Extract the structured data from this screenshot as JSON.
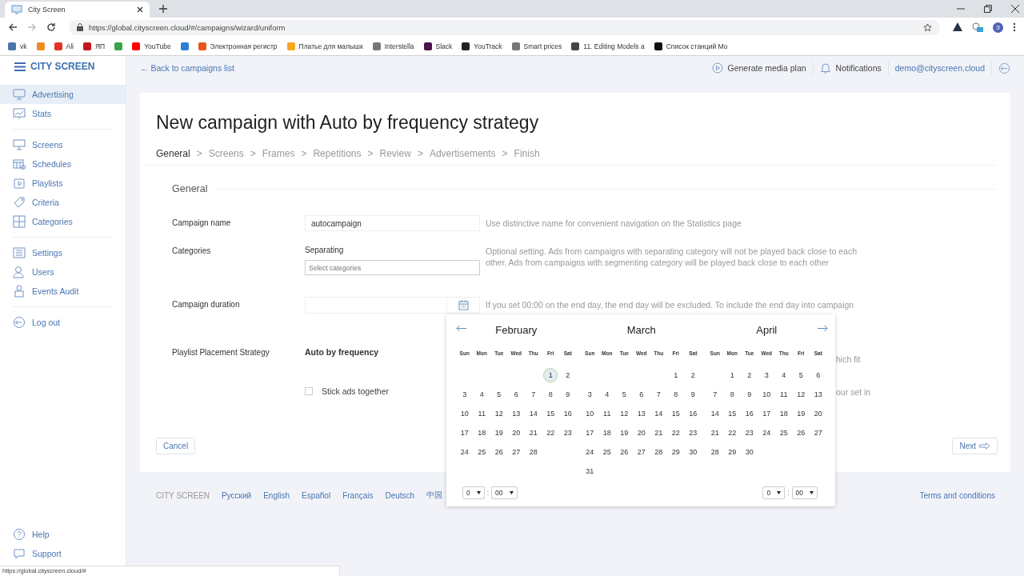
{
  "browser": {
    "tab_title": "City Screen",
    "url": "https://global.cityscreen.cloud/#/campaigns/wizard/uniform",
    "profile_initial": "З",
    "bookmarks": [
      {
        "label": "vk",
        "color": "#4a76a8"
      },
      {
        "color": "#f08a24"
      },
      {
        "label": "Ali",
        "color": "#e43225"
      },
      {
        "label": "ЯП",
        "color": "#c4161c"
      },
      {
        "color": "#3aa34a"
      },
      {
        "label": "YouTube",
        "color": "#ff0000"
      },
      {
        "color": "#2a7fd4"
      },
      {
        "label": "Электронная регистр",
        "color": "#e8541c"
      },
      {
        "label": "Платье для малышк",
        "color": "#f5a623"
      },
      {
        "label": "Interstella",
        "color": "#777777"
      },
      {
        "label": "Slack",
        "color": "#4a154b"
      },
      {
        "label": "YouTrack",
        "color": "#222222"
      },
      {
        "label": "Smart prices",
        "color": "#777777"
      },
      {
        "label": "11. Editing Models a",
        "color": "#444444"
      },
      {
        "label": "Список станций Mo",
        "color": "#111111"
      }
    ]
  },
  "sidebar": {
    "brand": "CITY SCREEN",
    "groups": [
      {
        "items": [
          {
            "label": "Advertising",
            "selected": true
          },
          {
            "label": "Stats",
            "selected": false
          }
        ]
      },
      {
        "items": [
          {
            "label": "Screens",
            "selected": false
          },
          {
            "label": "Schedules",
            "selected": false
          },
          {
            "label": "Playlists",
            "selected": false
          },
          {
            "label": "Criteria",
            "selected": false
          },
          {
            "label": "Categories",
            "selected": false
          }
        ]
      },
      {
        "items": [
          {
            "label": "Settings",
            "selected": false
          },
          {
            "label": "Users",
            "selected": false
          },
          {
            "label": "Events Audit",
            "selected": false
          }
        ]
      },
      {
        "items": [
          {
            "label": "Log out",
            "selected": false
          }
        ]
      }
    ],
    "bottom_items": [
      {
        "label": "Help",
        "selected": false
      },
      {
        "label": "Support",
        "selected": false
      }
    ]
  },
  "header": {
    "back_link": "← Back to campaigns list",
    "media_plan": "Generate media plan",
    "notifications": "Notifications",
    "user": "demo@cityscreen.cloud"
  },
  "page": {
    "title": "New campaign with Auto by frequency strategy",
    "separator": ">",
    "steps": [
      {
        "label": "General",
        "selected": true
      },
      {
        "label": "Screens",
        "selected": false
      },
      {
        "label": "Frames",
        "selected": false
      },
      {
        "label": "Repetitions",
        "selected": false
      },
      {
        "label": "Review",
        "selected": false
      },
      {
        "label": "Advertisements",
        "selected": false
      },
      {
        "label": "Finish",
        "selected": false
      }
    ],
    "section": "General",
    "campaign_name": {
      "label": "Campaign name",
      "value": "autocampaign",
      "hint": "Use distinctive name for convenient navigation on the Statistics page"
    },
    "categories": {
      "label": "Categories",
      "sublabel": "Separating",
      "placeholder": "Select categories",
      "hint": "Optional setting. Ads from campaigns with separating category will not be played back close to each other. Ads from campaigns with segmenting category will be played back close to each other"
    },
    "duration": {
      "label": "Campaign duration",
      "hint": "If you set 00:00 on the end day, the end day will be excluded. To include the end day into campaign"
    },
    "strategy": {
      "label": "Playlist Placement Strategy",
      "value": "Auto by frequency",
      "hint_fragment": "hich fit"
    },
    "stick_ads": {
      "label": "Stick ads together",
      "checked": false,
      "hint_fragment": "our set in"
    },
    "cancel": "Cancel",
    "next": "Next"
  },
  "calendar": {
    "months": [
      {
        "name": "February",
        "weekdays": [
          "Sun",
          "Mon",
          "Tue",
          "Wed",
          "Thu",
          "Fri",
          "Sat"
        ],
        "weeks": [
          [
            {
              "d": "1",
              "selected": true
            },
            {
              "d": "2",
              "selected": false
            }
          ],
          [
            {
              "d": "3",
              "selected": false
            },
            {
              "d": "4",
              "selected": false
            },
            {
              "d": "5",
              "selected": false
            },
            {
              "d": "6",
              "selected": false
            },
            {
              "d": "7",
              "selected": false
            },
            {
              "d": "8",
              "selected": false
            },
            {
              "d": "9",
              "selected": false
            }
          ],
          [
            {
              "d": "10",
              "selected": false
            },
            {
              "d": "11",
              "selected": false
            },
            {
              "d": "12",
              "selected": false
            },
            {
              "d": "13",
              "selected": false
            },
            {
              "d": "14",
              "selected": false
            },
            {
              "d": "15",
              "selected": false
            },
            {
              "d": "16",
              "selected": false
            }
          ],
          [
            {
              "d": "17",
              "selected": false
            },
            {
              "d": "18",
              "selected": false
            },
            {
              "d": "19",
              "selected": false
            },
            {
              "d": "20",
              "selected": false
            },
            {
              "d": "21",
              "selected": false
            },
            {
              "d": "22",
              "selected": false
            },
            {
              "d": "23",
              "selected": false
            }
          ],
          [
            {
              "d": "24",
              "selected": false
            },
            {
              "d": "25",
              "selected": false
            },
            {
              "d": "26",
              "selected": false
            },
            {
              "d": "27",
              "selected": false
            },
            {
              "d": "28",
              "selected": false
            }
          ]
        ]
      },
      {
        "name": "March",
        "weekdays": [
          "Sun",
          "Mon",
          "Tue",
          "Wed",
          "Thu",
          "Fri",
          "Sat"
        ],
        "weeks": [
          [
            {
              "d": "1",
              "selected": false
            },
            {
              "d": "2",
              "selected": false
            }
          ],
          [
            {
              "d": "3",
              "selected": false
            },
            {
              "d": "4",
              "selected": false
            },
            {
              "d": "5",
              "selected": false
            },
            {
              "d": "6",
              "selected": false
            },
            {
              "d": "7",
              "selected": false
            },
            {
              "d": "8",
              "selected": false
            },
            {
              "d": "9",
              "selected": false
            }
          ],
          [
            {
              "d": "10",
              "selected": false
            },
            {
              "d": "11",
              "selected": false
            },
            {
              "d": "12",
              "selected": false
            },
            {
              "d": "13",
              "selected": false
            },
            {
              "d": "14",
              "selected": false
            },
            {
              "d": "15",
              "selected": false
            },
            {
              "d": "16",
              "selected": false
            }
          ],
          [
            {
              "d": "17",
              "selected": false
            },
            {
              "d": "18",
              "selected": false
            },
            {
              "d": "19",
              "selected": false
            },
            {
              "d": "20",
              "selected": false
            },
            {
              "d": "21",
              "selected": false
            },
            {
              "d": "22",
              "selected": false
            },
            {
              "d": "23",
              "selected": false
            }
          ],
          [
            {
              "d": "24",
              "selected": false
            },
            {
              "d": "25",
              "selected": false
            },
            {
              "d": "26",
              "selected": false
            },
            {
              "d": "27",
              "selected": false
            },
            {
              "d": "28",
              "selected": false
            },
            {
              "d": "29",
              "selected": false
            },
            {
              "d": "30",
              "selected": false
            }
          ],
          [
            {
              "d": "31",
              "selected": false
            }
          ]
        ]
      },
      {
        "name": "April",
        "weekdays": [
          "Sun",
          "Mon",
          "Tue",
          "Wed",
          "Thu",
          "Fri",
          "Sat"
        ],
        "weeks": [
          [
            {
              "d": "1",
              "selected": false
            },
            {
              "d": "2",
              "selected": false
            },
            {
              "d": "3",
              "selected": false
            },
            {
              "d": "4",
              "selected": false
            },
            {
              "d": "5",
              "selected": false
            },
            {
              "d": "6",
              "selected": false
            }
          ],
          [
            {
              "d": "7",
              "selected": false
            },
            {
              "d": "8",
              "selected": false
            },
            {
              "d": "9",
              "selected": false
            },
            {
              "d": "10",
              "selected": false
            },
            {
              "d": "11",
              "selected": false
            },
            {
              "d": "12",
              "selected": false
            },
            {
              "d": "13",
              "selected": false
            }
          ],
          [
            {
              "d": "14",
              "selected": false
            },
            {
              "d": "15",
              "selected": false
            },
            {
              "d": "16",
              "selected": false
            },
            {
              "d": "17",
              "selected": false
            },
            {
              "d": "18",
              "selected": false
            },
            {
              "d": "19",
              "selected": false
            },
            {
              "d": "20",
              "selected": false
            }
          ],
          [
            {
              "d": "21",
              "selected": false
            },
            {
              "d": "22",
              "selected": false
            },
            {
              "d": "23",
              "selected": false
            },
            {
              "d": "24",
              "selected": false
            },
            {
              "d": "25",
              "selected": false
            },
            {
              "d": "26",
              "selected": false
            },
            {
              "d": "27",
              "selected": false
            }
          ],
          [
            {
              "d": "28",
              "selected": false
            },
            {
              "d": "29",
              "selected": false
            },
            {
              "d": "30",
              "selected": false
            }
          ]
        ]
      }
    ],
    "time_start": {
      "hour": "0",
      "separator": ":",
      "minute": "00"
    },
    "time_end": {
      "hour": "0",
      "separator": ":",
      "minute": "00"
    }
  },
  "footer": {
    "brand": "CITY SCREEN",
    "languages": [
      "Русский",
      "English",
      "Español",
      "Français",
      "Deutsch",
      "中国"
    ],
    "terms": "Terms and conditions"
  },
  "status_bar": "https://global.cityscreen.cloud/#"
}
